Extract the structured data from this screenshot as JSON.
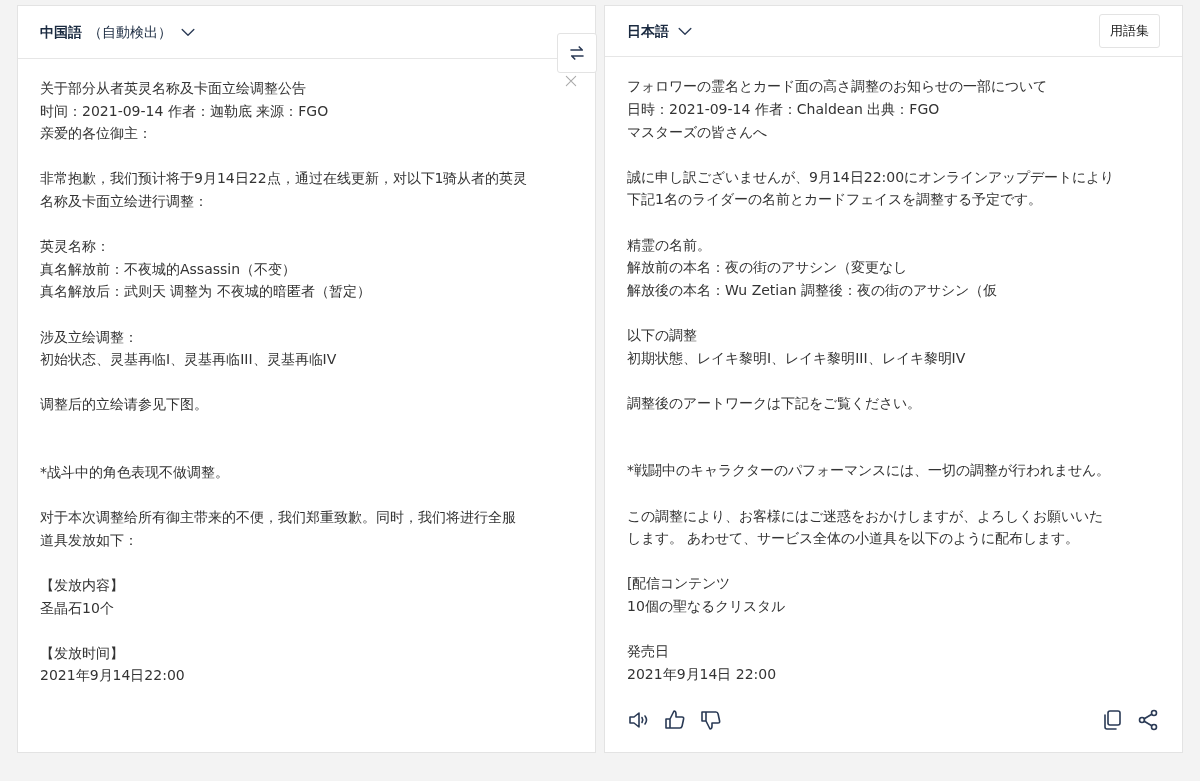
{
  "source": {
    "language": "中国語",
    "detected": "（自動検出）",
    "paragraphs": [
      {
        "lines": [
          "关于部分从者英灵名称及卡面立绘调整公告",
          "时间：2021-09-14  作者：迦勒底  来源：FGO",
          "亲爱的各位御主："
        ]
      },
      {
        "lines": [
          "非常抱歉，我们预计将于9月14日22点，通过在线更新，对以下1骑从者的英灵",
          "名称及卡面立绘进行调整："
        ]
      },
      {
        "lines": [
          "英灵名称：",
          "真名解放前：不夜城的Assassin（不变）",
          "真名解放后：武则天  调整为  不夜城的暗匿者（暂定）"
        ]
      },
      {
        "lines": [
          "涉及立绘调整：",
          "初始状态、灵基再临I、灵基再临III、灵基再临IV"
        ]
      },
      {
        "lines": [
          "调整后的立绘请参见下图。"
        ],
        "extra_gap": true
      },
      {
        "lines": [
          "*战斗中的角色表现不做调整。"
        ]
      },
      {
        "lines": [
          "对于本次调整给所有御主带来的不便，我们郑重致歉。同时，我们将进行全服",
          "道具发放如下："
        ]
      },
      {
        "lines": [
          "【发放内容】",
          "圣晶石10个"
        ]
      },
      {
        "lines": [
          "【发放时间】",
          "2021年9月14日22:00"
        ]
      }
    ]
  },
  "target": {
    "language": "日本語",
    "glossary_button": "用語集",
    "paragraphs": [
      {
        "lines": [
          "フォロワーの霊名とカード面の高さ調整のお知らせの一部について",
          "日時：2021-09-14 作者：Chaldean 出典：FGO",
          "マスターズの皆さんへ"
        ]
      },
      {
        "lines": [
          "誠に申し訳ございませんが、9月14日22:00にオンラインアップデートにより",
          "下記1名のライダーの名前とカードフェイスを調整する予定です。"
        ]
      },
      {
        "lines": [
          "精霊の名前。",
          "解放前の本名：夜の街のアサシン（変更なし",
          "解放後の本名：Wu Zetian 調整後：夜の街のアサシン（仮"
        ]
      },
      {
        "lines": [
          "以下の調整",
          "初期状態、レイキ黎明I、レイキ黎明III、レイキ黎明IV"
        ]
      },
      {
        "lines": [
          "調整後のアートワークは下記をご覧ください。"
        ],
        "extra_gap": true
      },
      {
        "lines": [
          "*戦闘中のキャラクターのパフォーマンスには、一切の調整が行われません。"
        ]
      },
      {
        "lines": [
          "この調整により、お客様にはご迷惑をおかけしますが、よろしくお願いいた",
          "します。 あわせて、サービス全体の小道具を以下のように配布します。"
        ]
      },
      {
        "lines": [
          "[配信コンテンツ",
          "10個の聖なるクリスタル"
        ]
      },
      {
        "lines": [
          "発売日",
          "2021年9月14日 22:00"
        ]
      }
    ]
  }
}
